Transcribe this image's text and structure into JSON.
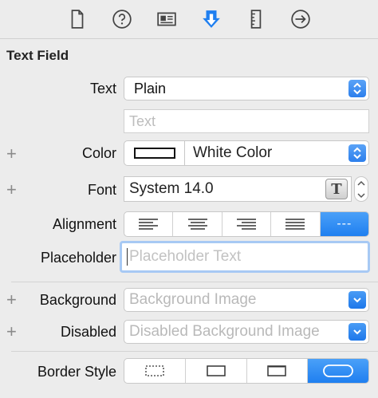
{
  "toolbar": {
    "icons": [
      "file-icon",
      "help-icon",
      "identity-icon",
      "attributes-icon",
      "size-ruler-icon",
      "connections-arrow-icon"
    ],
    "accent": "#1f7ff0"
  },
  "section_title": "Text Field",
  "rows": {
    "text": {
      "label": "Text",
      "value": "Plain",
      "field_placeholder": "Text"
    },
    "color": {
      "label": "Color",
      "value": "White Color"
    },
    "font": {
      "label": "Font",
      "value": "System 14.0"
    },
    "alignment": {
      "label": "Alignment",
      "options": [
        "align-left",
        "align-center",
        "align-right",
        "justify",
        "natural"
      ],
      "selected": "natural",
      "natural_glyph": "---"
    },
    "placeholder": {
      "label": "Placeholder",
      "value": "Placeholder Text"
    },
    "background": {
      "label": "Background",
      "value": "Background Image"
    },
    "disabled": {
      "label": "Disabled",
      "value": "Disabled Background Image"
    },
    "border_style": {
      "label": "Border Style",
      "options": [
        "none-dotted",
        "line",
        "bezel",
        "rounded"
      ],
      "selected": "rounded"
    }
  },
  "plus_glyph": "+"
}
